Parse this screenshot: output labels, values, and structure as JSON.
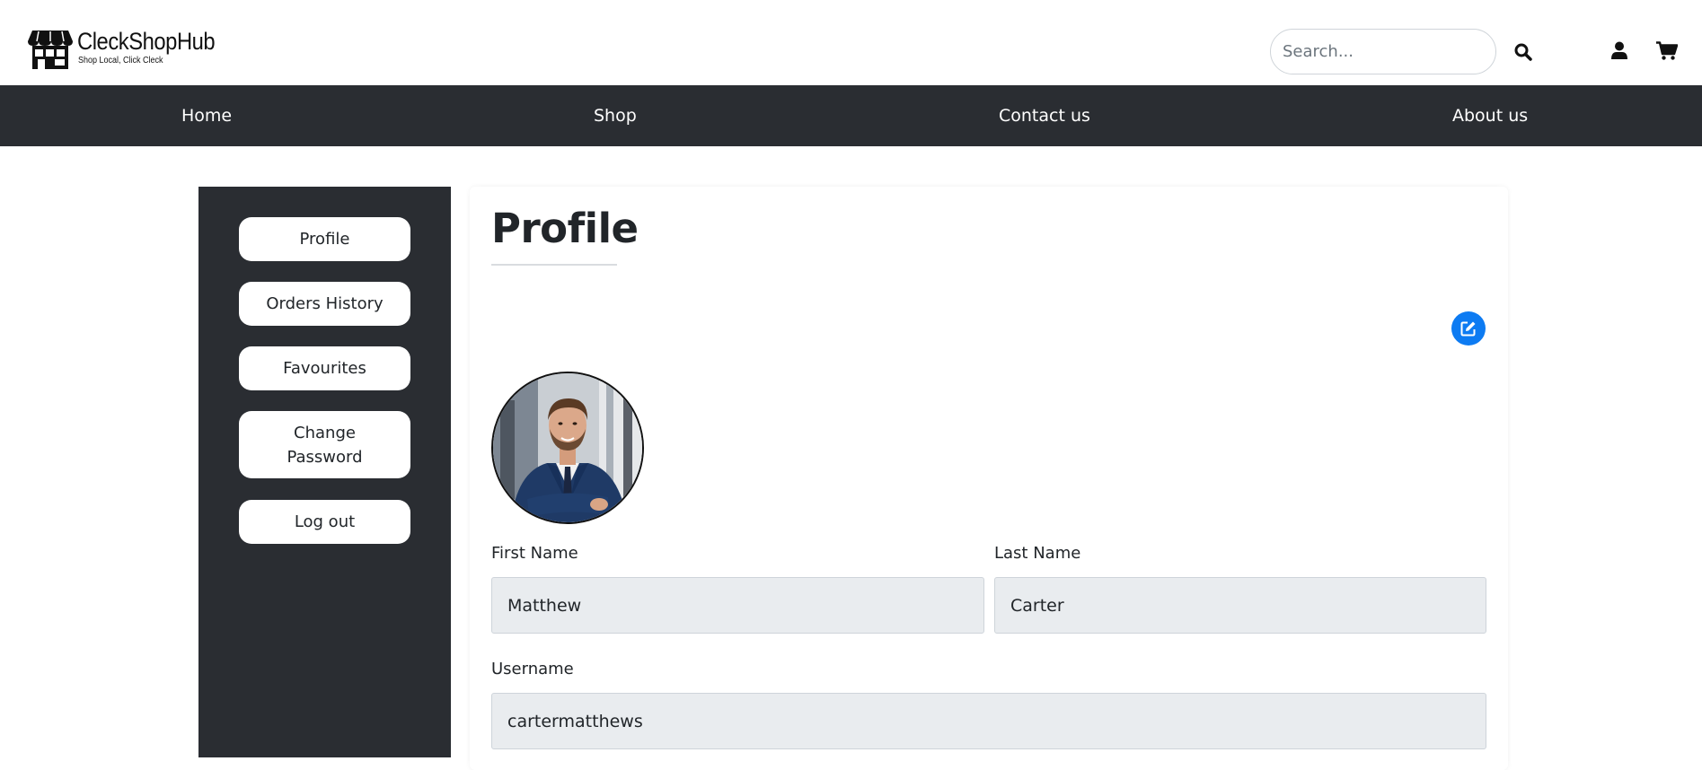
{
  "brand": {
    "name": "CleckShopHub",
    "tagline": "Shop Local, Click Cleck"
  },
  "search": {
    "placeholder": "Search...",
    "value": ""
  },
  "icons": {
    "search": "search-icon",
    "user": "user-icon",
    "cart": "cart-icon",
    "edit": "edit-icon",
    "logo": "storefront-icon"
  },
  "nav": {
    "home": "Home",
    "shop": "Shop",
    "contact": "Contact us",
    "about": "About us"
  },
  "sidebar": {
    "items": [
      {
        "label": "Profile"
      },
      {
        "label": "Orders History"
      },
      {
        "label": "Favourites"
      },
      {
        "label": "Change Password"
      },
      {
        "label": "Log out"
      }
    ]
  },
  "profile": {
    "title": "Profile",
    "first_name_label": "First Name",
    "first_name": "Matthew",
    "last_name_label": "Last Name",
    "last_name": "Carter",
    "username_label": "Username",
    "username": "cartermatthews"
  },
  "colors": {
    "nav_bg": "#2a2d32",
    "accent": "#0d7bf2",
    "field_bg": "#e9ecef"
  }
}
